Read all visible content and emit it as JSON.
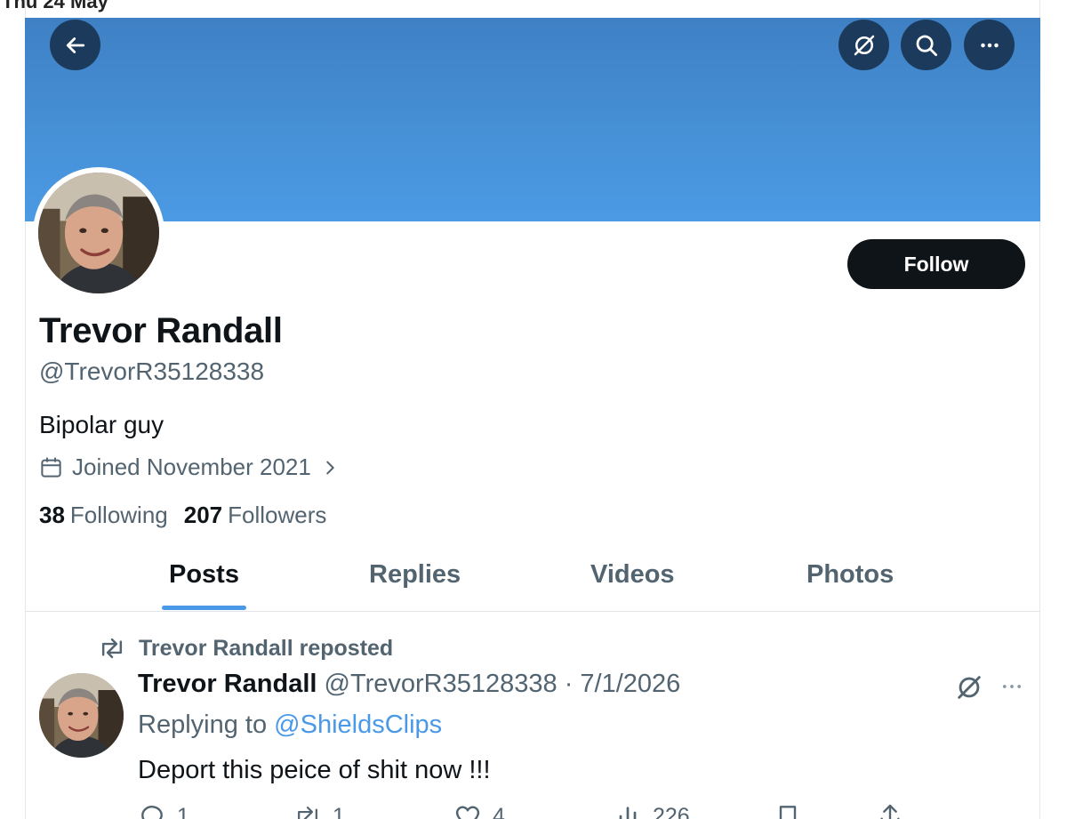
{
  "status_bar": {
    "text": "Thu 24 May"
  },
  "header": {
    "back_icon": "arrow-left-icon",
    "grok_icon": "grok-icon",
    "search_icon": "search-icon",
    "more_icon": "more-horizontal-icon",
    "banner_color": "#4690d6"
  },
  "profile": {
    "display_name": "Trevor Randall",
    "handle": "@TrevorR35128338",
    "bio": "Bipolar guy",
    "joined": "Joined November 2021",
    "following_count": "38",
    "following_label": "Following",
    "followers_count": "207",
    "followers_label": "Followers",
    "follow_label": "Follow"
  },
  "tabs": [
    {
      "label": "Posts",
      "active": true
    },
    {
      "label": "Replies",
      "active": false
    },
    {
      "label": "Videos",
      "active": false
    },
    {
      "label": "Photos",
      "active": false
    }
  ],
  "post": {
    "repost_label": "Trevor Randall reposted",
    "author_name": "Trevor Randall",
    "author_meta": "@TrevorR35128338 · 7/1/2026",
    "replying_prefix": "Replying to",
    "replying_handle": "@ShieldsClips",
    "text": "Deport this peice of shit now !!!",
    "actions": {
      "replies": "1",
      "reposts": "1",
      "likes": "4",
      "views": "226"
    }
  },
  "colors": {
    "accent": "#4a99e9",
    "follow_button": "#0f1419",
    "muted_text": "#536471"
  }
}
